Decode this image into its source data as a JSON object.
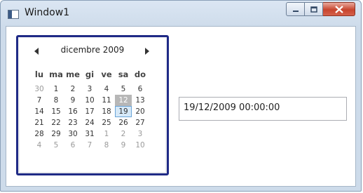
{
  "window": {
    "title": "Window1",
    "controls": {
      "minimize": "minimize",
      "maximize": "maximize",
      "close": "close"
    }
  },
  "calendar": {
    "month_label": "dicembre 2009",
    "weekdays": [
      "lu",
      "ma",
      "me",
      "gi",
      "ve",
      "sa",
      "do"
    ],
    "weeks": [
      [
        {
          "d": "30",
          "other": true
        },
        {
          "d": "1"
        },
        {
          "d": "2"
        },
        {
          "d": "3"
        },
        {
          "d": "4"
        },
        {
          "d": "5"
        },
        {
          "d": "6"
        }
      ],
      [
        {
          "d": "7"
        },
        {
          "d": "8"
        },
        {
          "d": "9"
        },
        {
          "d": "10"
        },
        {
          "d": "11"
        },
        {
          "d": "12",
          "state": "today"
        },
        {
          "d": "13"
        }
      ],
      [
        {
          "d": "14"
        },
        {
          "d": "15"
        },
        {
          "d": "16"
        },
        {
          "d": "17"
        },
        {
          "d": "18"
        },
        {
          "d": "19",
          "state": "selected"
        },
        {
          "d": "20"
        }
      ],
      [
        {
          "d": "21"
        },
        {
          "d": "22"
        },
        {
          "d": "23"
        },
        {
          "d": "24"
        },
        {
          "d": "25"
        },
        {
          "d": "26"
        },
        {
          "d": "27"
        }
      ],
      [
        {
          "d": "28"
        },
        {
          "d": "29"
        },
        {
          "d": "30"
        },
        {
          "d": "31"
        },
        {
          "d": "1",
          "other": true
        },
        {
          "d": "2",
          "other": true
        },
        {
          "d": "3",
          "other": true
        }
      ],
      [
        {
          "d": "4",
          "other": true
        },
        {
          "d": "5",
          "other": true
        },
        {
          "d": "6",
          "other": true
        },
        {
          "d": "7",
          "other": true
        },
        {
          "d": "8",
          "other": true
        },
        {
          "d": "9",
          "other": true
        },
        {
          "d": "10",
          "other": true
        }
      ]
    ],
    "colors": {
      "border": "#1f2a86",
      "today": "#b7b7b7",
      "selected": "#d6e9f8"
    }
  },
  "date_field": {
    "value": "19/12/2009 00:00:00"
  }
}
